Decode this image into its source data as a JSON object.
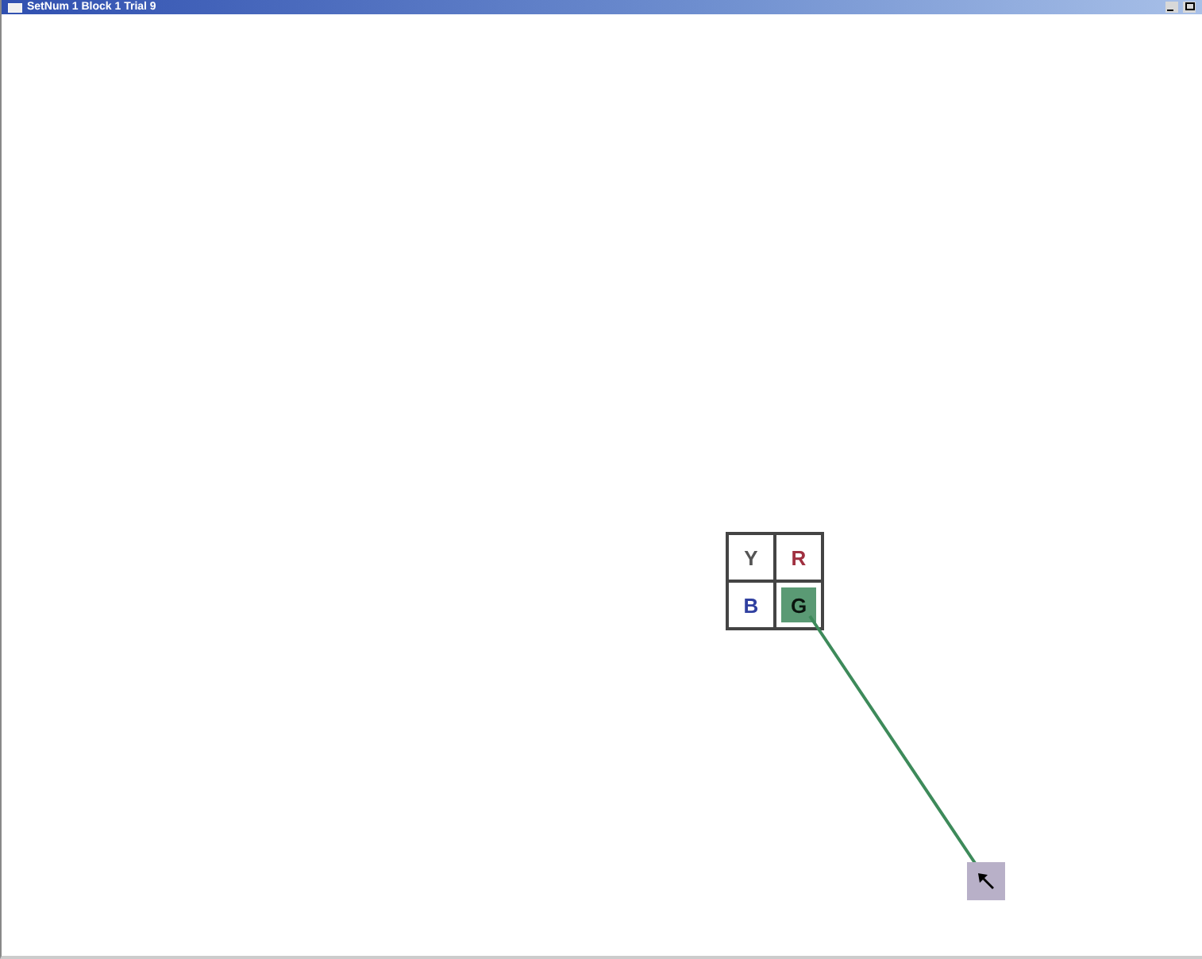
{
  "window": {
    "title": "SetNum 1 Block 1 Trial 9"
  },
  "grid": {
    "cells": [
      {
        "letter": "Y",
        "color": "#555555",
        "selected": false
      },
      {
        "letter": "R",
        "color": "#a03040",
        "selected": false
      },
      {
        "letter": "B",
        "color": "#3040a0",
        "selected": false
      },
      {
        "letter": "G",
        "color": "#0a140e",
        "selected": true
      }
    ]
  }
}
